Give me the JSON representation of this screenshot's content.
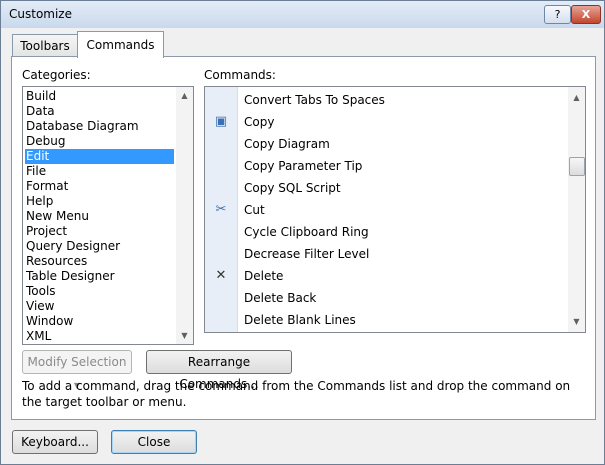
{
  "window": {
    "title": "Customize",
    "help_label": "?",
    "close_label": "X"
  },
  "tabs": [
    {
      "label": "Toolbars"
    },
    {
      "label": "Commands"
    }
  ],
  "categories": {
    "label": "Categories:",
    "selected": "Edit",
    "items": [
      "Build",
      "Data",
      "Database Diagram",
      "Debug",
      "Edit",
      "File",
      "Format",
      "Help",
      "New Menu",
      "Project",
      "Query Designer",
      "Resources",
      "Table Designer",
      "Tools",
      "View",
      "Window",
      "XML"
    ]
  },
  "commands": {
    "label": "Commands:",
    "items": [
      {
        "icon": "",
        "label": "Convert Tabs To Spaces"
      },
      {
        "icon": "copy-icon",
        "label": "Copy"
      },
      {
        "icon": "",
        "label": "Copy Diagram"
      },
      {
        "icon": "",
        "label": "Copy Parameter Tip"
      },
      {
        "icon": "",
        "label": "Copy SQL Script"
      },
      {
        "icon": "cut-icon",
        "label": "Cut"
      },
      {
        "icon": "",
        "label": "Cycle Clipboard Ring"
      },
      {
        "icon": "",
        "label": "Decrease Filter Level"
      },
      {
        "icon": "delete-icon",
        "label": "Delete"
      },
      {
        "icon": "",
        "label": "Delete Back"
      },
      {
        "icon": "",
        "label": "Delete Blank Lines"
      }
    ]
  },
  "buttons": {
    "modify_selection": "Modify Selection",
    "rearrange_commands": "Rearrange Commands...",
    "keyboard": "Keyboard...",
    "close": "Close"
  },
  "info_text": "To add a command, drag the command from the Commands list and drop the command on the target toolbar or menu."
}
